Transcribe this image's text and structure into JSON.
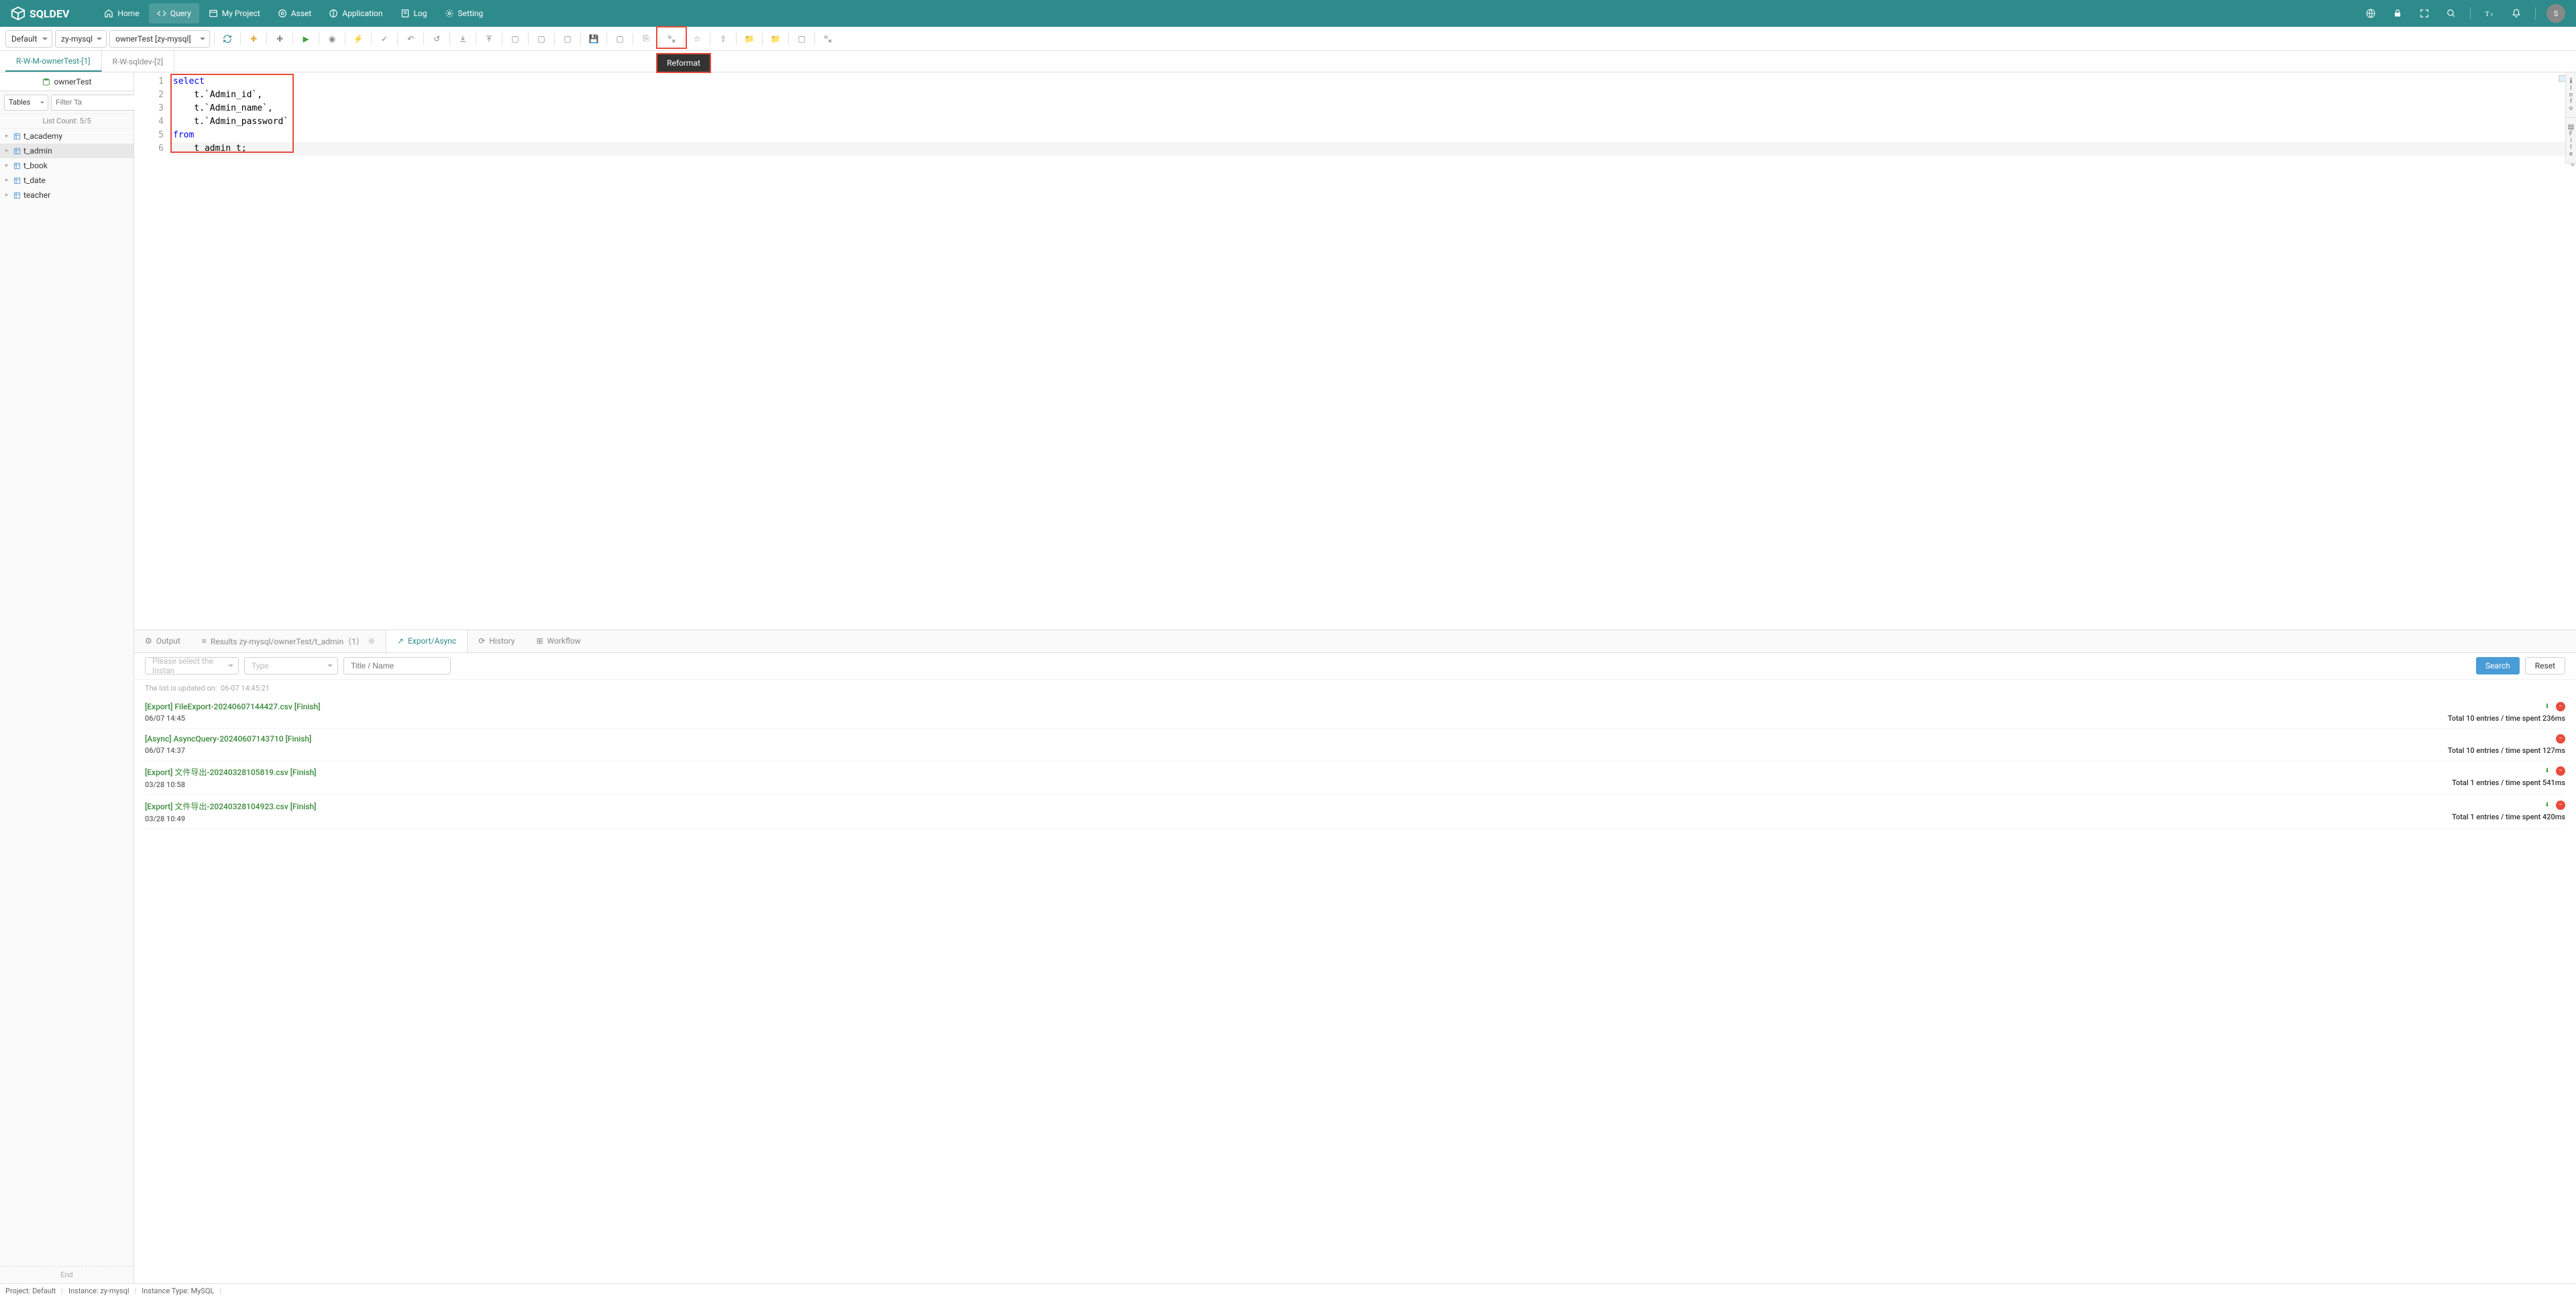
{
  "app": {
    "name": "SQLDEV"
  },
  "nav": {
    "items": [
      {
        "label": "Home",
        "icon": "home"
      },
      {
        "label": "Query",
        "icon": "code",
        "active": true
      },
      {
        "label": "My Project",
        "icon": "project"
      },
      {
        "label": "Asset",
        "icon": "asset"
      },
      {
        "label": "Application",
        "icon": "app"
      },
      {
        "label": "Log",
        "icon": "log"
      },
      {
        "label": "Setting",
        "icon": "gear"
      }
    ],
    "avatar_letter": "S"
  },
  "toolbar": {
    "selects": [
      {
        "value": "Default"
      },
      {
        "value": "zy-mysql"
      },
      {
        "value": "ownerTest [zy-mysql]"
      }
    ],
    "tooltip": "Reformat"
  },
  "tabs": [
    {
      "label": "R-W-M-ownerTest-[1]",
      "active": true
    },
    {
      "label": "R-W-sqldev-[2]",
      "active": false
    }
  ],
  "sidebar": {
    "db_name": "ownerTest",
    "filter_label": "Tables",
    "filter_placeholder": "Filter Ta",
    "list_count_label": "List Count:",
    "list_count_value": "5/5",
    "tables": [
      {
        "name": "t_academy",
        "selected": false
      },
      {
        "name": "t_admin",
        "selected": true
      },
      {
        "name": "t_book",
        "selected": false
      },
      {
        "name": "t_date",
        "selected": false
      },
      {
        "name": "teacher",
        "selected": false
      }
    ],
    "end_label": "End"
  },
  "editor": {
    "lines": [
      {
        "n": 1,
        "tokens": [
          {
            "t": "select",
            "c": "kw"
          }
        ]
      },
      {
        "n": 2,
        "tokens": [
          {
            "t": "    t.`Admin_id`,",
            "c": "plain"
          }
        ]
      },
      {
        "n": 3,
        "tokens": [
          {
            "t": "    t.`Admin_name`,",
            "c": "plain"
          }
        ]
      },
      {
        "n": 4,
        "tokens": [
          {
            "t": "    t.`Admin_password`",
            "c": "plain"
          }
        ]
      },
      {
        "n": 5,
        "tokens": [
          {
            "t": "from",
            "c": "kw"
          }
        ]
      },
      {
        "n": 6,
        "tokens": [
          {
            "t": "    t_admin t;",
            "c": "plain"
          }
        ],
        "current": true
      }
    ]
  },
  "results": {
    "tabs": [
      {
        "label": "Output",
        "icon": "⚙"
      },
      {
        "label": "Results zy-mysql/ownerTest/t_admin（1）",
        "icon": "≡",
        "closable": true
      },
      {
        "label": "Export/Async",
        "icon": "↗",
        "active": true
      },
      {
        "label": "History",
        "icon": "⟳"
      },
      {
        "label": "Workflow",
        "icon": "⊞"
      }
    ],
    "filter": {
      "instance_placeholder": "Please select the Instan",
      "type_placeholder": "Type",
      "title_placeholder": "Title / Name",
      "search_label": "Search",
      "reset_label": "Reset"
    },
    "list_updated_label": "The list is updated on:",
    "list_updated_time": "06-07 14:45:21",
    "exports": [
      {
        "title": "[Export] FileExport-20240607144427.csv [Finish]",
        "time": "06/07 14:45",
        "stats": "Total 10 entries / time spent 236ms",
        "has_download": true
      },
      {
        "title": "[Async] AsyncQuery-20240607143710 [Finish]",
        "time": "06/07 14:37",
        "stats": "Total 10 entries / time spent 127ms",
        "has_download": false
      },
      {
        "title": "[Export] 文件导出-20240328105819.csv [Finish]",
        "time": "03/28 10:58",
        "stats": "Total 1 entries / time spent 541ms",
        "has_download": true
      },
      {
        "title": "[Export] 文件导出-20240328104923.csv [Finish]",
        "time": "03/28 10:49",
        "stats": "Total 1 entries / time spent 420ms",
        "has_download": true
      }
    ]
  },
  "right_tabs": [
    {
      "label": "Info",
      "icon": "ℹ"
    },
    {
      "label": "File",
      "icon": "▤"
    }
  ],
  "status": {
    "project_label": "Project:",
    "project_value": "Default",
    "instance_label": "Instance:",
    "instance_value": "zy-mysql",
    "instance_type_label": "Instance Type:",
    "instance_type_value": "MySQL"
  }
}
